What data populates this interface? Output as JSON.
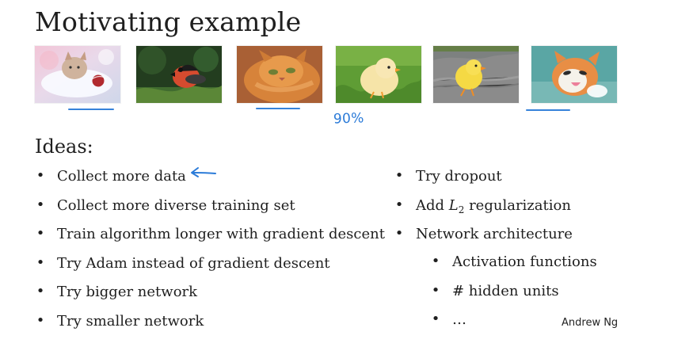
{
  "slide": {
    "title": "Motivating example",
    "images": [
      {
        "name": "kitten-red-ball",
        "icon": "kitten-image"
      },
      {
        "name": "bullfinch-bird",
        "icon": "bird-image"
      },
      {
        "name": "orange-cat-lying",
        "icon": "cat-image"
      },
      {
        "name": "chick-on-grass",
        "icon": "chick-image"
      },
      {
        "name": "chick-on-wood",
        "icon": "chick-image"
      },
      {
        "name": "cat-licking",
        "icon": "cat-image"
      }
    ],
    "annotation": "90%",
    "ideas_title": "Ideas:",
    "left_items": [
      "Collect more data",
      "Collect more diverse training set",
      "Train algorithm longer with gradient descent",
      "Try Adam instead of gradient descent",
      "Try bigger network",
      "Try smaller network"
    ],
    "right_items": {
      "item1": "Try dropout",
      "item2_prefix": "Add ",
      "item2_math": "L",
      "item2_sub": "2",
      "item2_suffix": " regularization",
      "item3": "Network architecture"
    },
    "sub_items": [
      "Activation functions",
      "# hidden units",
      "…"
    ],
    "bullet": "•",
    "credit": "Andrew Ng",
    "colors": {
      "annotation": "#2b7bd8",
      "text": "#1f1f1f"
    }
  }
}
